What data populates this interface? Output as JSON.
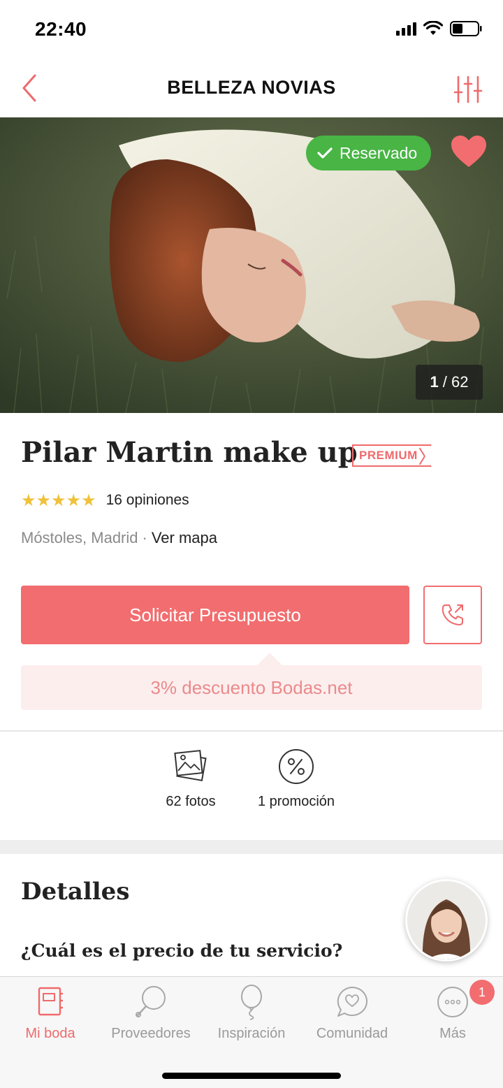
{
  "status_bar": {
    "time": "22:40"
  },
  "header": {
    "title": "BELLEZA NOVIAS"
  },
  "hero": {
    "reserved_label": "Reservado",
    "photo_current": "1",
    "photo_total": "/ 62",
    "favorite": true
  },
  "vendor": {
    "name": "Pilar Martin make up",
    "badge": "PREMIUM",
    "rating_stars": "★★★★★",
    "reviews": "16 opiniones",
    "location": "Móstoles, Madrid",
    "separator": "·",
    "map_link": "Ver mapa"
  },
  "actions": {
    "quote_button": "Solicitar Presupuesto",
    "discount": "3% descuento Bodas.net"
  },
  "stats": {
    "photos": "62 fotos",
    "promotions": "1 promoción"
  },
  "details": {
    "title": "Detalles",
    "question": "¿Cuál es el precio de tu servicio?"
  },
  "tab_bar": {
    "items": [
      {
        "label": "Mi boda",
        "icon": "wedding-book-icon",
        "active": true
      },
      {
        "label": "Proveedores",
        "icon": "magnifier-icon",
        "active": false
      },
      {
        "label": "Inspiración",
        "icon": "balloon-icon",
        "active": false
      },
      {
        "label": "Comunidad",
        "icon": "chat-heart-icon",
        "active": false
      },
      {
        "label": "Más",
        "icon": "more-icon",
        "active": false,
        "badge": "1"
      }
    ]
  },
  "colors": {
    "accent": "#f26d6f",
    "reserved_green": "#48b545",
    "star": "#f0c13a"
  }
}
